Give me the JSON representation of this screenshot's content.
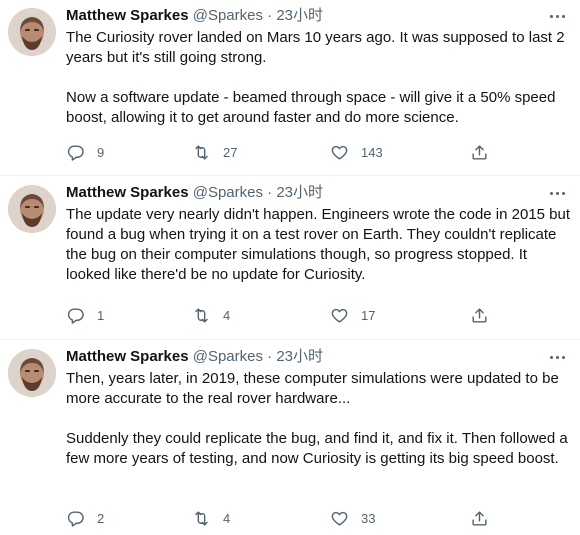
{
  "tweets": [
    {
      "author": "Matthew Sparkes",
      "handle": "@Sparkes",
      "dot": "·",
      "time": "23小时",
      "paragraphs": [
        "The Curiosity rover landed on Mars 10 years ago. It was supposed to last 2 years but it's still going strong.",
        "Now a software update - beamed through space - will give it a 50% speed boost, allowing it to get around faster and do more science."
      ],
      "replies": "9",
      "retweets": "27",
      "likes": "143"
    },
    {
      "author": "Matthew Sparkes",
      "handle": "@Sparkes",
      "dot": "·",
      "time": "23小时",
      "paragraphs": [
        "The update very nearly didn't happen. Engineers wrote the code in 2015 but found a bug when trying it on a test rover on Earth. They couldn't replicate the bug on their computer simulations though, so progress stopped. It looked like there'd be no update for Curiosity."
      ],
      "replies": "1",
      "retweets": "4",
      "likes": "17"
    },
    {
      "author": "Matthew Sparkes",
      "handle": "@Sparkes",
      "dot": "·",
      "time": "23小时",
      "paragraphs": [
        "Then, years later, in 2019, these computer simulations were updated to be more accurate to the real rover hardware...",
        "Suddenly they could replicate the bug, and find it, and fix it. Then followed a few more years of testing, and now Curiosity is getting its big speed boost."
      ],
      "replies": "2",
      "retweets": "4",
      "likes": "33"
    }
  ],
  "icons": {
    "reply": "reply-icon",
    "retweet": "retweet-icon",
    "like": "heart-icon",
    "share": "share-icon",
    "more": "more-icon"
  },
  "colors": {
    "text": "#0f1419",
    "secondary": "#536471",
    "divider": "#eff3f4"
  }
}
